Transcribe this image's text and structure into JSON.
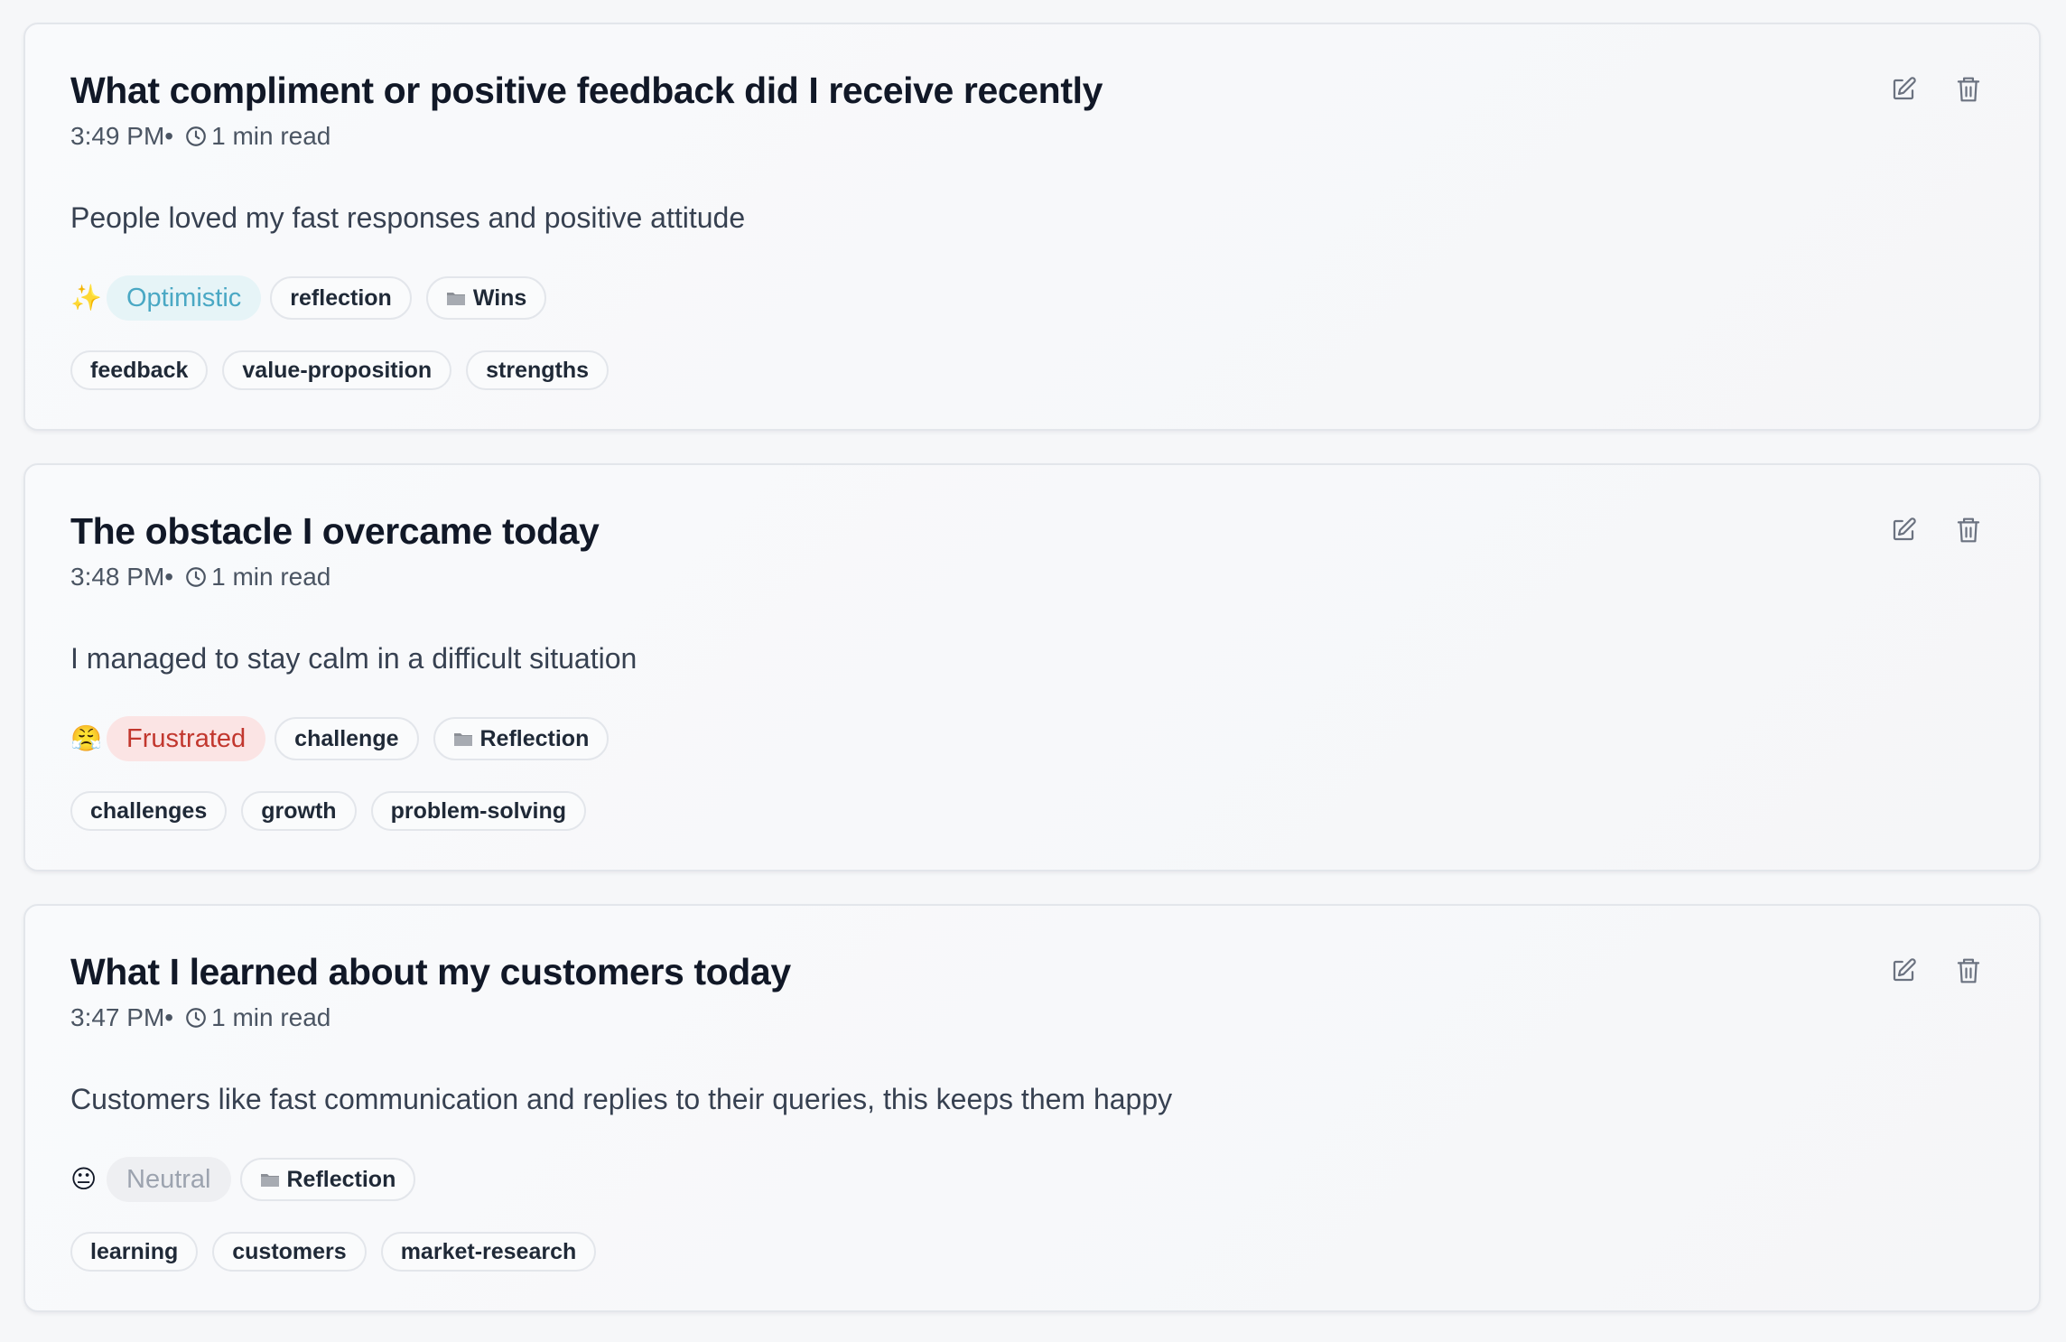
{
  "entries": [
    {
      "title": "What compliment or positive feedback did I receive recently",
      "time": "3:49 PM",
      "separator": "•",
      "read_time": "1 min read",
      "body": "People loved my fast responses and positive attitude",
      "mood": {
        "emoji": "✨",
        "label": "Optimistic",
        "color": "#4aa8c4",
        "bg": "#e6f4f7"
      },
      "type_chip": "reflection",
      "category": {
        "icon": "folder-icon",
        "label": "Wins"
      },
      "tags": [
        "feedback",
        "value-proposition",
        "strengths"
      ]
    },
    {
      "title": "The obstacle I overcame today",
      "time": "3:48 PM",
      "separator": "•",
      "read_time": "1 min read",
      "body": "I managed to stay calm in a difficult situation",
      "mood": {
        "emoji": "😤",
        "label": "Frustrated",
        "color": "#c2372e",
        "bg": "#fbe4e4"
      },
      "type_chip": "challenge",
      "category": {
        "icon": "folder-icon",
        "label": "Reflection"
      },
      "tags": [
        "challenges",
        "growth",
        "problem-solving"
      ]
    },
    {
      "title": "What I learned about my customers today",
      "time": "3:47 PM",
      "separator": "•",
      "read_time": "1 min read",
      "body": "Customers like fast communication and replies to their queries, this keeps them happy",
      "mood": {
        "emoji": "😐",
        "label": "Neutral",
        "color": "#9ca3af",
        "bg": "#eeeff2"
      },
      "category": {
        "icon": "folder-icon",
        "label": "Reflection"
      },
      "tags": [
        "learning",
        "customers",
        "market-research"
      ]
    }
  ],
  "icons": {
    "edit": "edit-icon",
    "delete": "trash-icon",
    "time": "clock-icon"
  }
}
